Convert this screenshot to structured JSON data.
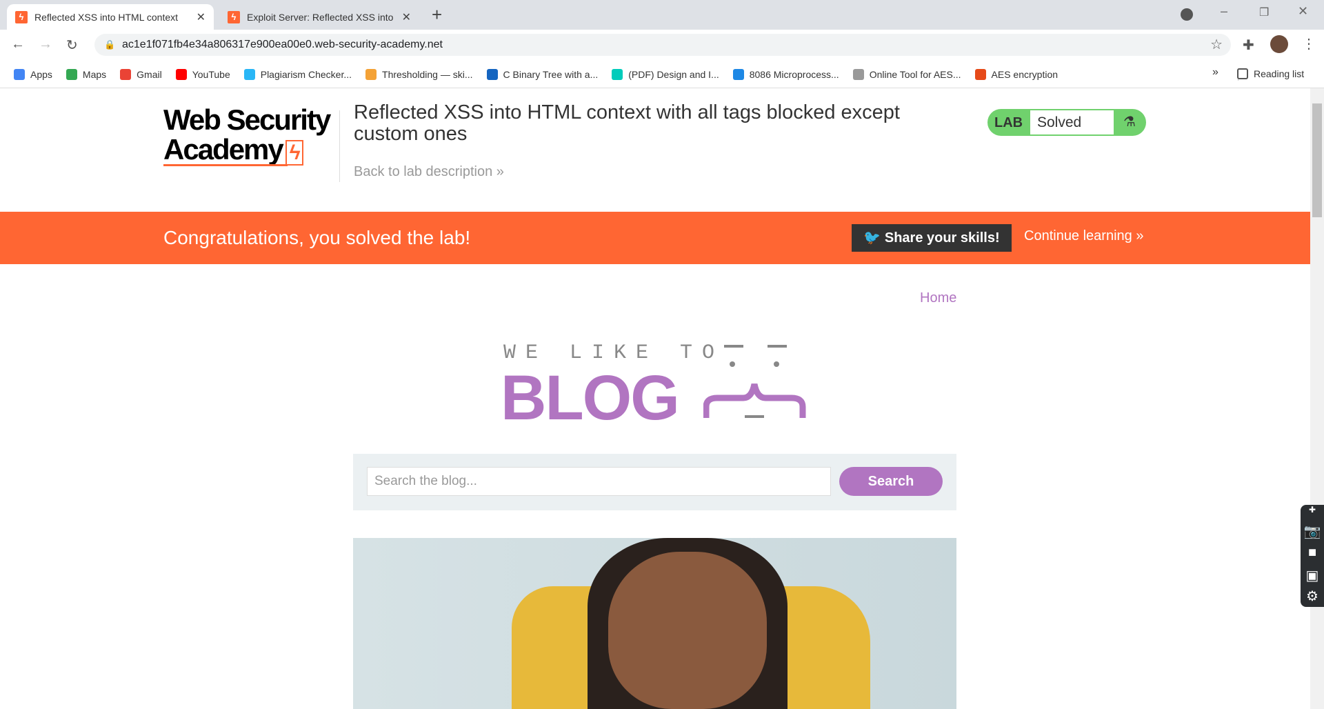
{
  "browser": {
    "tabs": [
      {
        "title": "Reflected XSS into HTML context",
        "active": true
      },
      {
        "title": "Exploit Server: Reflected XSS into",
        "active": false
      }
    ],
    "url": "ac1e1f071fb4e34a806317e900ea00e0.web-security-academy.net",
    "bookmarks": [
      {
        "label": "Apps",
        "color": "#4285f4"
      },
      {
        "label": "Maps",
        "color": "#34a853"
      },
      {
        "label": "Gmail",
        "color": "#ea4335"
      },
      {
        "label": "YouTube",
        "color": "#ff0000"
      },
      {
        "label": "Plagiarism Checker...",
        "color": "#29b6f6"
      },
      {
        "label": "Thresholding — ski...",
        "color": "#f4a236"
      },
      {
        "label": "C Binary Tree with a...",
        "color": "#1565c0"
      },
      {
        "label": "(PDF) Design and I...",
        "color": "#00ccbb"
      },
      {
        "label": "8086 Microprocess...",
        "color": "#1e88e5"
      },
      {
        "label": "Online Tool for AES...",
        "color": "#999999"
      },
      {
        "label": "AES encryption",
        "color": "#e64a19"
      }
    ],
    "reading_list": "Reading list"
  },
  "header": {
    "logo": "Web Security Academy",
    "title": "Reflected XSS into HTML context with all tags blocked except custom ones",
    "back_link": "Back to lab description »",
    "lab_label": "LAB",
    "lab_status": "Solved"
  },
  "banner": {
    "message": "Congratulations, you solved the lab!",
    "share": "Share your skills!",
    "continue": "Continue learning »"
  },
  "blog": {
    "home": "Home",
    "tagline": "WE LIKE TO",
    "name": "BLOG",
    "search_placeholder": "Search the blog...",
    "search_button": "Search"
  },
  "colors": {
    "accent": "#ff6633",
    "purple": "#b175c1",
    "lab_green": "#70d16d"
  }
}
